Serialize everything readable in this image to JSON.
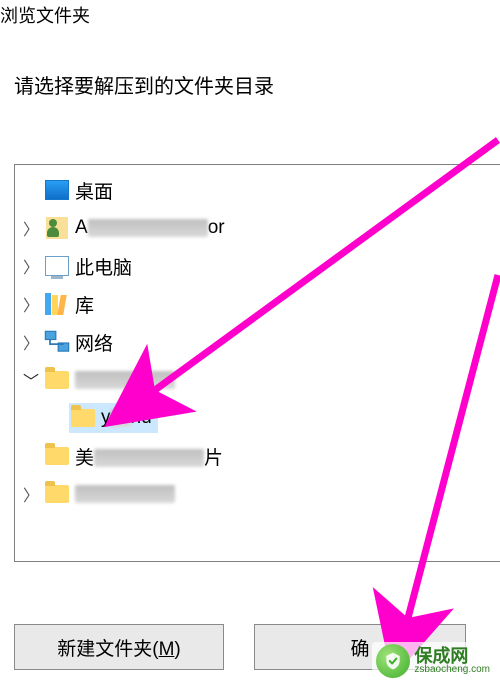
{
  "window": {
    "title": "浏览文件夹"
  },
  "instruction": "请选择要解压到的文件夹目录",
  "tree": {
    "root": {
      "label": "桌面",
      "icon": "desktop-icon"
    },
    "items": [
      {
        "label_prefix": "A",
        "label_suffix": "or",
        "icon": "user-icon",
        "expandable": true,
        "censored": true
      },
      {
        "label": "此电脑",
        "icon": "pc-icon",
        "expandable": true
      },
      {
        "label": "库",
        "icon": "library-icon",
        "expandable": true
      },
      {
        "label": "网络",
        "icon": "network-icon",
        "expandable": true
      },
      {
        "label": "",
        "icon": "folder-icon",
        "expandable": true,
        "censored": true
      },
      {
        "label_prefix": "y",
        "label_suffix": "hu",
        "icon": "folder-icon",
        "expandable": false,
        "selected": true,
        "indent": 2
      },
      {
        "label_prefix": "美",
        "label_suffix": "片",
        "icon": "folder-icon",
        "expandable": false,
        "censored_mid": true
      },
      {
        "label": "",
        "icon": "folder-icon",
        "expandable": true,
        "censored": true
      }
    ]
  },
  "buttons": {
    "new_folder": "新建文件夹(M)",
    "ok": "确"
  },
  "watermark": {
    "cn": "保成网",
    "en": "zsbaocheng.com"
  }
}
